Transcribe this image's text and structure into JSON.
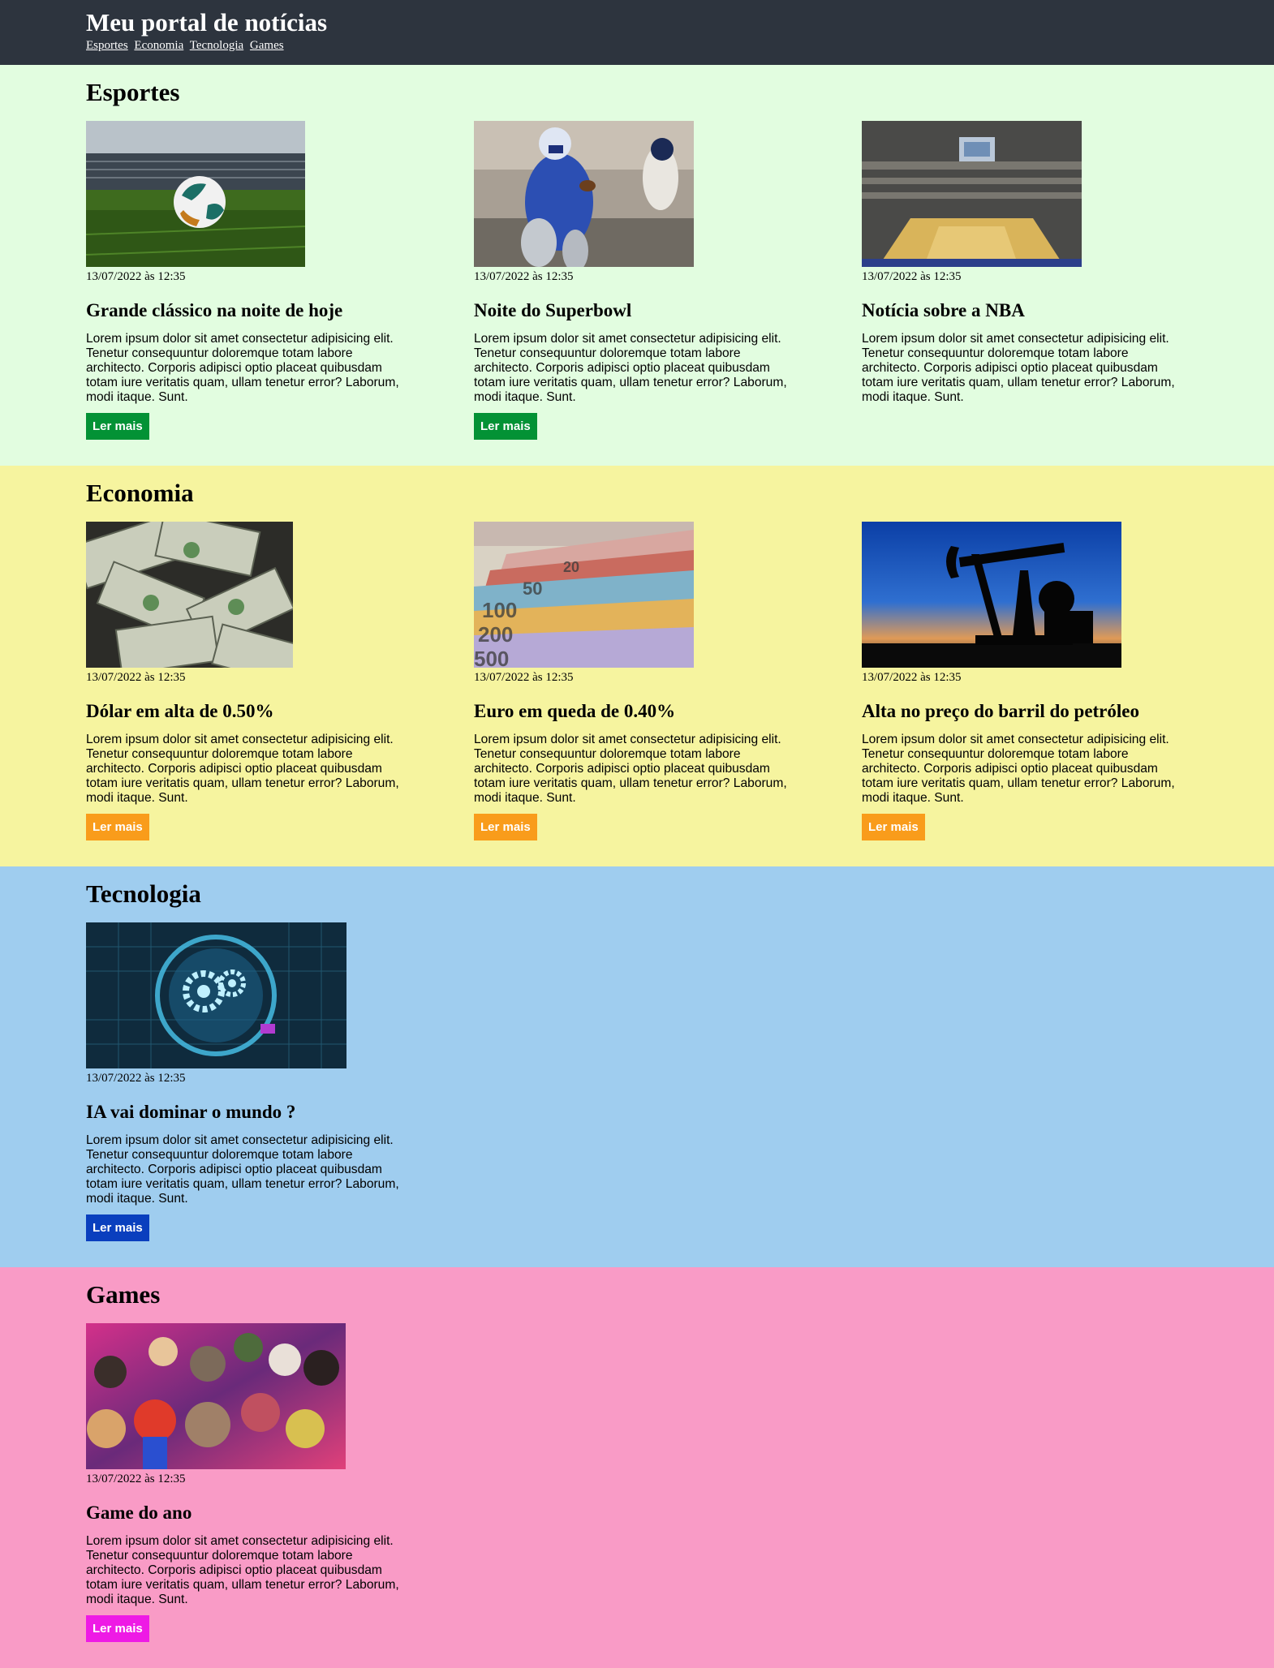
{
  "header": {
    "title": "Meu portal de notícias",
    "nav": [
      "Esportes",
      "Economia",
      "Tecnologia",
      "Games"
    ]
  },
  "colors": {
    "header_bg": "#2d343e",
    "esportes_bg": "#e2fde0",
    "economia_bg": "#f6f49f",
    "tecnologia_bg": "#9fcdef",
    "games_bg": "#f99bc6",
    "esportes_btn": "#039235",
    "economia_btn": "#f99c1b",
    "tecnologia_btn": "#0a3fbe",
    "games_btn": "#ee1ae5"
  },
  "common": {
    "date": "13/07/2022 às 12:35",
    "lorem": "Lorem ipsum dolor sit amet consectetur adipisicing elit. Tenetur consequuntur doloremque totam labore architecto. Corporis adipisci optio placeat quibusdam totam iure veritatis quam, ullam tenetur error? Laborum, modi itaque. Sunt.",
    "button": "Ler mais"
  },
  "sections": {
    "esportes": {
      "title": "Esportes",
      "cards": [
        {
          "title": "Grande clássico na noite de hoje",
          "image": "soccer-ball-stadium-image",
          "has_button": true
        },
        {
          "title": "Noite do Superbowl",
          "image": "american-football-player-image",
          "has_button": true
        },
        {
          "title": "Notícia sobre a NBA",
          "image": "basketball-arena-image",
          "has_button": false
        }
      ]
    },
    "economia": {
      "title": "Economia",
      "cards": [
        {
          "title": "Dólar em alta de 0.50%",
          "image": "dollar-bills-image",
          "has_button": true
        },
        {
          "title": "Euro em queda de 0.40%",
          "image": "euro-banknotes-image",
          "has_button": true
        },
        {
          "title": "Alta no preço do barril do petróleo",
          "image": "oil-pump-sunset-image",
          "has_button": true
        }
      ]
    },
    "tecnologia": {
      "title": "Tecnologia",
      "cards": [
        {
          "title": "IA vai dominar o mundo ?",
          "image": "ai-gears-circuit-image",
          "has_button": true
        }
      ]
    },
    "games": {
      "title": "Games",
      "cards": [
        {
          "title": "Game do ano",
          "image": "game-characters-collage-image",
          "has_button": true
        }
      ]
    }
  }
}
